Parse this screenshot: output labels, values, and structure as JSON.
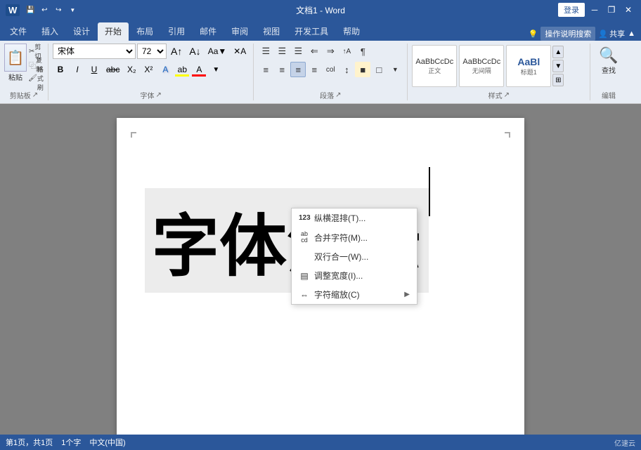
{
  "titlebar": {
    "title": "文档1 - Word",
    "login_label": "登录",
    "quick_access": [
      "save",
      "undo",
      "redo",
      "customize"
    ],
    "win_btns": [
      "minimize",
      "restore",
      "close"
    ]
  },
  "ribbon_tabs": [
    {
      "label": "文件",
      "active": false
    },
    {
      "label": "插入",
      "active": false
    },
    {
      "label": "设计",
      "active": false
    },
    {
      "label": "开始",
      "active": true
    },
    {
      "label": "布局",
      "active": false
    },
    {
      "label": "引用",
      "active": false
    },
    {
      "label": "邮件",
      "active": false
    },
    {
      "label": "审阅",
      "active": false
    },
    {
      "label": "视图",
      "active": false
    },
    {
      "label": "开发工具",
      "active": false
    },
    {
      "label": "帮助",
      "active": false
    }
  ],
  "ribbon_right": {
    "search_placeholder": "操作说明搜索",
    "share_label": "共享"
  },
  "clipboard": {
    "group_label": "剪贴板",
    "paste_label": "粘贴",
    "cut_label": "剪切",
    "copy_label": "复制",
    "format_painter_label": "格式刷"
  },
  "font": {
    "group_label": "字体",
    "font_name": "宋体",
    "font_size": "72",
    "grow_label": "增大字号",
    "shrink_label": "减小字号",
    "change_case_label": "更改大小写",
    "clear_format_label": "清除格式",
    "bold_label": "B",
    "italic_label": "I",
    "underline_label": "U",
    "strikethrough_label": "abc",
    "subscript_label": "X₂",
    "superscript_label": "X²",
    "text_effects_label": "A",
    "highlight_label": "ab",
    "font_color_label": "A"
  },
  "paragraph": {
    "group_label": "段落",
    "bullets_label": "≡",
    "numbering_label": "≡",
    "multilevel_label": "≡",
    "decrease_indent_label": "⇐",
    "increase_indent_label": "⇒",
    "sort_label": "↑A",
    "show_marks_label": "¶",
    "align_left_label": "≡",
    "align_center_label": "≡",
    "align_right_label": "≡",
    "justify_label": "≡",
    "col_label": "col",
    "line_spacing_label": "↕",
    "shading_label": "■",
    "border_label": "□"
  },
  "styles": {
    "group_label": "样式",
    "items": [
      {
        "label": "正文",
        "preview": "AaBbCcDc",
        "style": "normal"
      },
      {
        "label": "无间隔",
        "preview": "AaBbCcDc",
        "style": "no-space"
      },
      {
        "label": "标题1",
        "preview": "AaBl",
        "style": "heading1"
      }
    ]
  },
  "edit": {
    "group_label": "编辑",
    "search_label": "查找"
  },
  "doc": {
    "main_text": "字体演示"
  },
  "dropdown_menu": {
    "items": [
      {
        "label": "纵横混排(T)...",
        "icon": "123",
        "has_sub": false
      },
      {
        "label": "合并字符(M)...",
        "icon": "ab/cd",
        "has_sub": false
      },
      {
        "label": "双行合一(W)...",
        "icon": "",
        "has_sub": false
      },
      {
        "label": "调整宽度(I)...",
        "icon": "调",
        "has_sub": false
      },
      {
        "label": "字符缩放(C)",
        "icon": "缩",
        "has_sub": true
      }
    ]
  },
  "status": {
    "page_info": "第1页，共1页",
    "word_count": "1个字",
    "lang": "中文(中国)",
    "watermark": "亿速云"
  }
}
